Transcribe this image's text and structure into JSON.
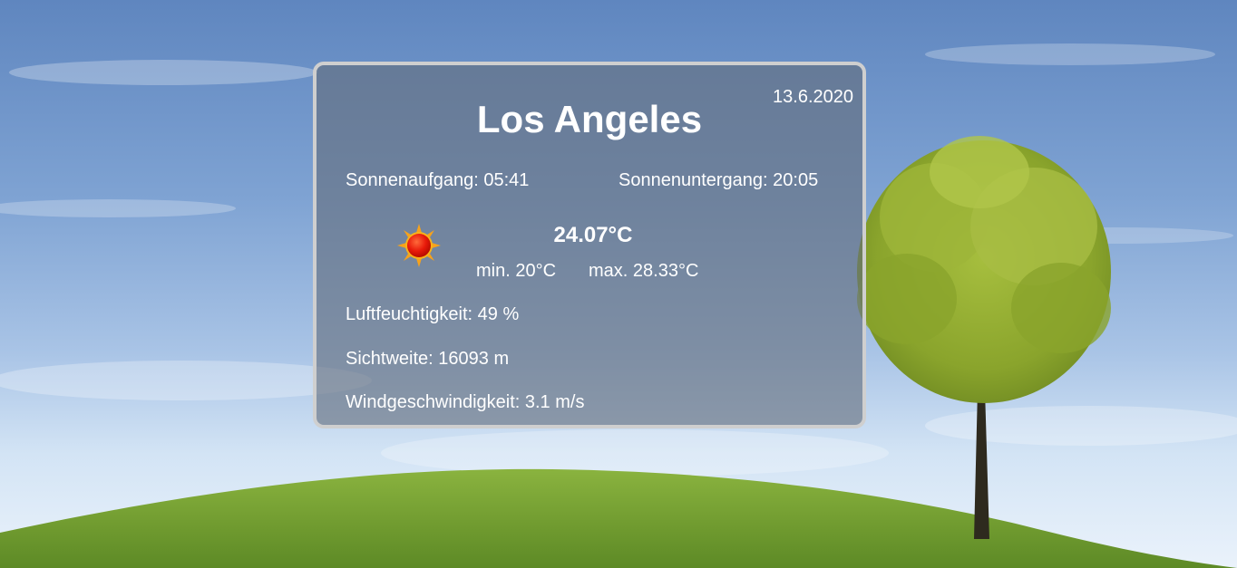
{
  "weather": {
    "city": "Los Angeles",
    "date": "13.6.2020",
    "sunrise": "Sonnenaufgang: 05:41",
    "sunset": "Sonnenuntergang: 20:05",
    "temperature": "24.07°C",
    "min": "min. 20°C",
    "max": "max. 28.33°C",
    "humidity": "Luftfeuchtigkeit: 49 %",
    "visibility": "Sichtweite: 16093 m",
    "wind": "Windgeschwindigkeit: 3.1 m/s",
    "icon": "sun-icon"
  },
  "colors": {
    "sky_top": "#5f86bf",
    "grass": "#7da63a",
    "card_border": "#cfcfcf",
    "text": "#ffffff"
  }
}
